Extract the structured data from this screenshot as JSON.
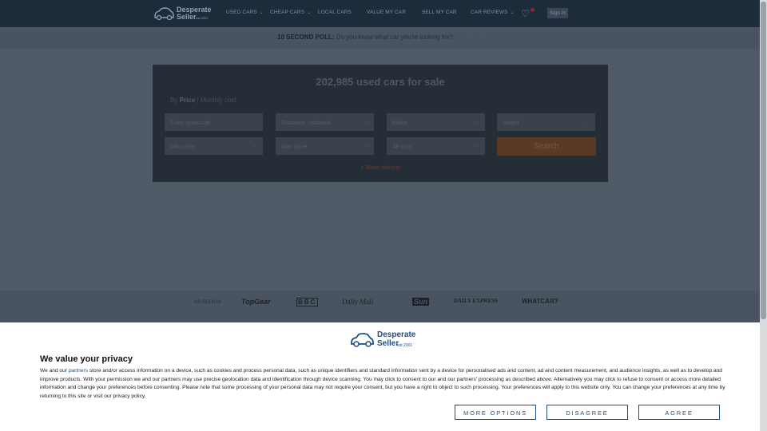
{
  "header": {
    "logo": {
      "line1": "Desperate",
      "line2": "Seller",
      "tagline": "est.2001"
    },
    "nav": [
      {
        "label": "USED CARS",
        "has_dropdown": true
      },
      {
        "label": "CHEAP CARS",
        "has_dropdown": true
      },
      {
        "label": "LOCAL CARS",
        "has_dropdown": false
      },
      {
        "label": "VALUE MY CAR",
        "has_dropdown": false
      },
      {
        "label": "SELL MY CAR",
        "has_dropdown": false
      },
      {
        "label": "CAR REVIEWS",
        "has_dropdown": true
      }
    ],
    "favourites_icon": "heart-icon",
    "signin_label": "Sign in"
  },
  "poll": {
    "bold": "10 SECOND POLL:",
    "text": " Do you know what car you're looking for?",
    "link": "Answer now"
  },
  "search": {
    "title": "202,985 used cars for sale",
    "by_label": "By",
    "mode_price": "Price",
    "mode_separator": "|",
    "mode_monthly": "Monthly cost",
    "postcode_placeholder": "Enter postcode",
    "distance": "Distance - national",
    "make": "Make",
    "model": "Model",
    "min_price": "Min price",
    "max_price": "Max price",
    "body_type": "All cars",
    "search_button": "Search",
    "more_options": "+ More options"
  },
  "as_seen_in": {
    "label": "AS SEEN IN",
    "brands": [
      "TopGear",
      "BBC",
      "Daily Mail",
      "Sun",
      "DAILY EXPRESS",
      "WHATCAR?"
    ]
  },
  "consent": {
    "logo": {
      "line1": "Desperate",
      "line2": "Seller",
      "tagline": "est.2001"
    },
    "title": "We value your privacy",
    "body_pre": "We and our ",
    "partners_link": "partners",
    "body_post": " store and/or access information on a device, such as cookies and process personal data, such as unique identifiers and standard information sent by a device for personalised ads and content, ad and content measurement, and audience insights, as well as to develop and improve products. With your permission we and our partners may use precise geolocation data and identification through device scanning. You may click to consent to our and our partners' processing as described above. Alternatively you may click to refuse to consent or access more detailed information and change your preferences before consenting. Please note that some processing of your personal data may not require your consent, but you have a right to object to such processing. Your preferences will apply to this website only. You can change your preferences at any time by returning to this site or visit our privacy policy.",
    "buttons": {
      "more_options": "MORE OPTIONS",
      "disagree": "DISAGREE",
      "agree": "AGREE"
    }
  },
  "colors": {
    "navy": "#1d2b3b",
    "accent_orange": "#d8692a",
    "consent_blue": "#1c4f85"
  }
}
